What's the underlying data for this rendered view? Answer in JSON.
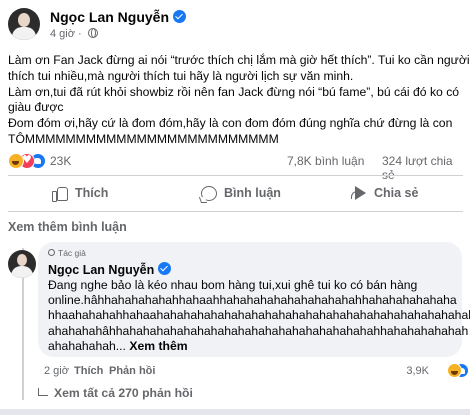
{
  "post": {
    "author": "Ngọc Lan Nguyễn",
    "time": "4 giờ",
    "privacy_icon": "globe-icon",
    "lines": [
      "Làm ơn Fan Jack đừng ai nói “trước thích chị lắm mà giờ hết thích”. Tui ko cần người",
      "thích tui nhiều,mà người thích tui hãy là người lịch sự văn minh.",
      "Làm ơn,tui đã rút khỏi showbiz rồi nên fan Jack đừng nói “bú fame”, bú cái đó ko có",
      "giàu được",
      "Đom đóm ơi,hãy cứ là đom đóm,hãy là con đom đóm đúng nghĩa chứ đừng là con",
      "TÔMMMMMMMMMMMMMMMMMMMMMMMMM"
    ]
  },
  "stats": {
    "reaction_count": "23K",
    "comment_count": "7,8K bình luận",
    "share_count": "324 lượt chia sẻ",
    "reaction_icons": [
      "haha-icon",
      "love-icon",
      "like-icon"
    ]
  },
  "actions": {
    "like": "Thích",
    "comment": "Bình luận",
    "share": "Chia sẻ"
  },
  "more_comments": "Xem thêm bình luận",
  "comment": {
    "badge": "Tác giả",
    "author": "Ngọc Lan Nguyễn",
    "lines": [
      "Đang nghe bảo là kéo nhau bom hàng tui,xui ghê tui ko có bán hàng",
      "online.hâhhahahahahahhahaahhahahahahahahahahahahhahahahahahaha",
      "hhaahahahahhahaahahahahahahahahahahahahahahahahahahahahahahahah",
      "ahahahahâhhahahahahahahahahahahahahahahahahahahahhahahahahahah",
      "ahahahahah..."
    ],
    "see_more": "Xem thêm",
    "time": "2 giờ",
    "like_label": "Thích",
    "reply_label": "Phản hồi",
    "reaction_count": "3,9K",
    "view_replies": "Xem tất cả 270 phản hồi"
  },
  "colors": {
    "brand_blue": "#1877f2",
    "secondary_text": "#65676b",
    "bubble_bg": "#f0f2f5"
  }
}
